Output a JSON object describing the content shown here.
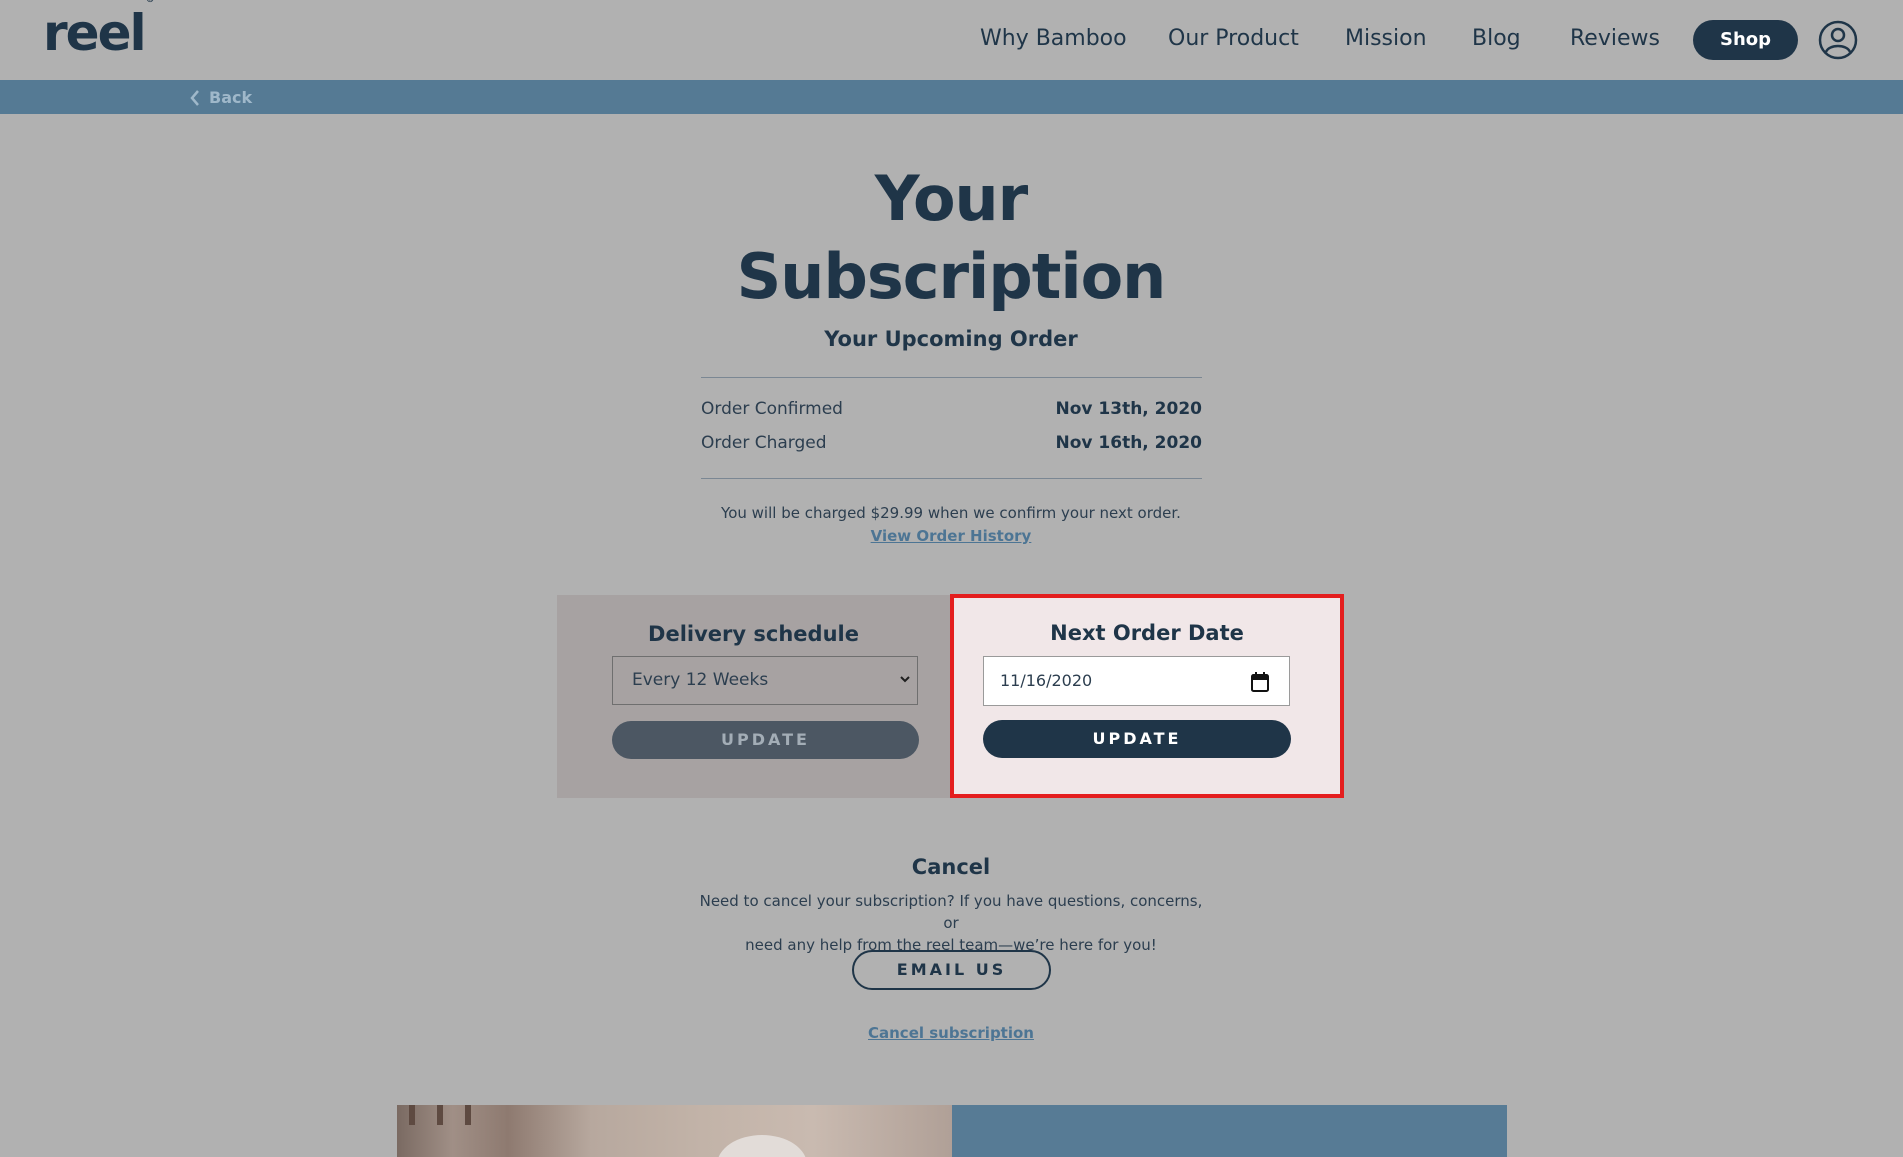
{
  "header": {
    "logo": "reel",
    "logo_mark": "®",
    "nav": [
      "Why Bamboo",
      "Our Product",
      "Mission",
      "Blog",
      "Reviews"
    ],
    "shop_label": "Shop",
    "account_icon": "user-circle-icon"
  },
  "subnav": {
    "back_label": "Back",
    "back_icon": "chevron-left-icon"
  },
  "page": {
    "title_line1": "Your",
    "title_line2": "Subscription",
    "subtitle": "Your Upcoming Order"
  },
  "order": {
    "rows": [
      {
        "label": "Order Confirmed",
        "value": "Nov 13th, 2020"
      },
      {
        "label": "Order Charged",
        "value": "Nov 16th, 2020"
      }
    ],
    "charge_note": "You will be charged $29.99 when we confirm your next order.",
    "history_link": "View Order History"
  },
  "delivery": {
    "title": "Delivery schedule",
    "selected": "Every 12 Weeks",
    "update_label": "UPDATE"
  },
  "next_order": {
    "title": "Next Order Date",
    "date_value": "11/16/2020",
    "calendar_icon": "calendar-icon",
    "update_label": "UPDATE"
  },
  "cancel": {
    "title": "Cancel",
    "text_line1": "Need to cancel your subscription? If you have questions, concerns, or",
    "text_line2": "need any help from the reel team—we’re here for you!",
    "email_label": "EMAIL US",
    "cancel_link": "Cancel subscription"
  },
  "colors": {
    "navy": "#1f3548",
    "steel_blue": "#557a94",
    "page_bg": "#b1b1b1",
    "highlight_border": "#e41e1e"
  }
}
